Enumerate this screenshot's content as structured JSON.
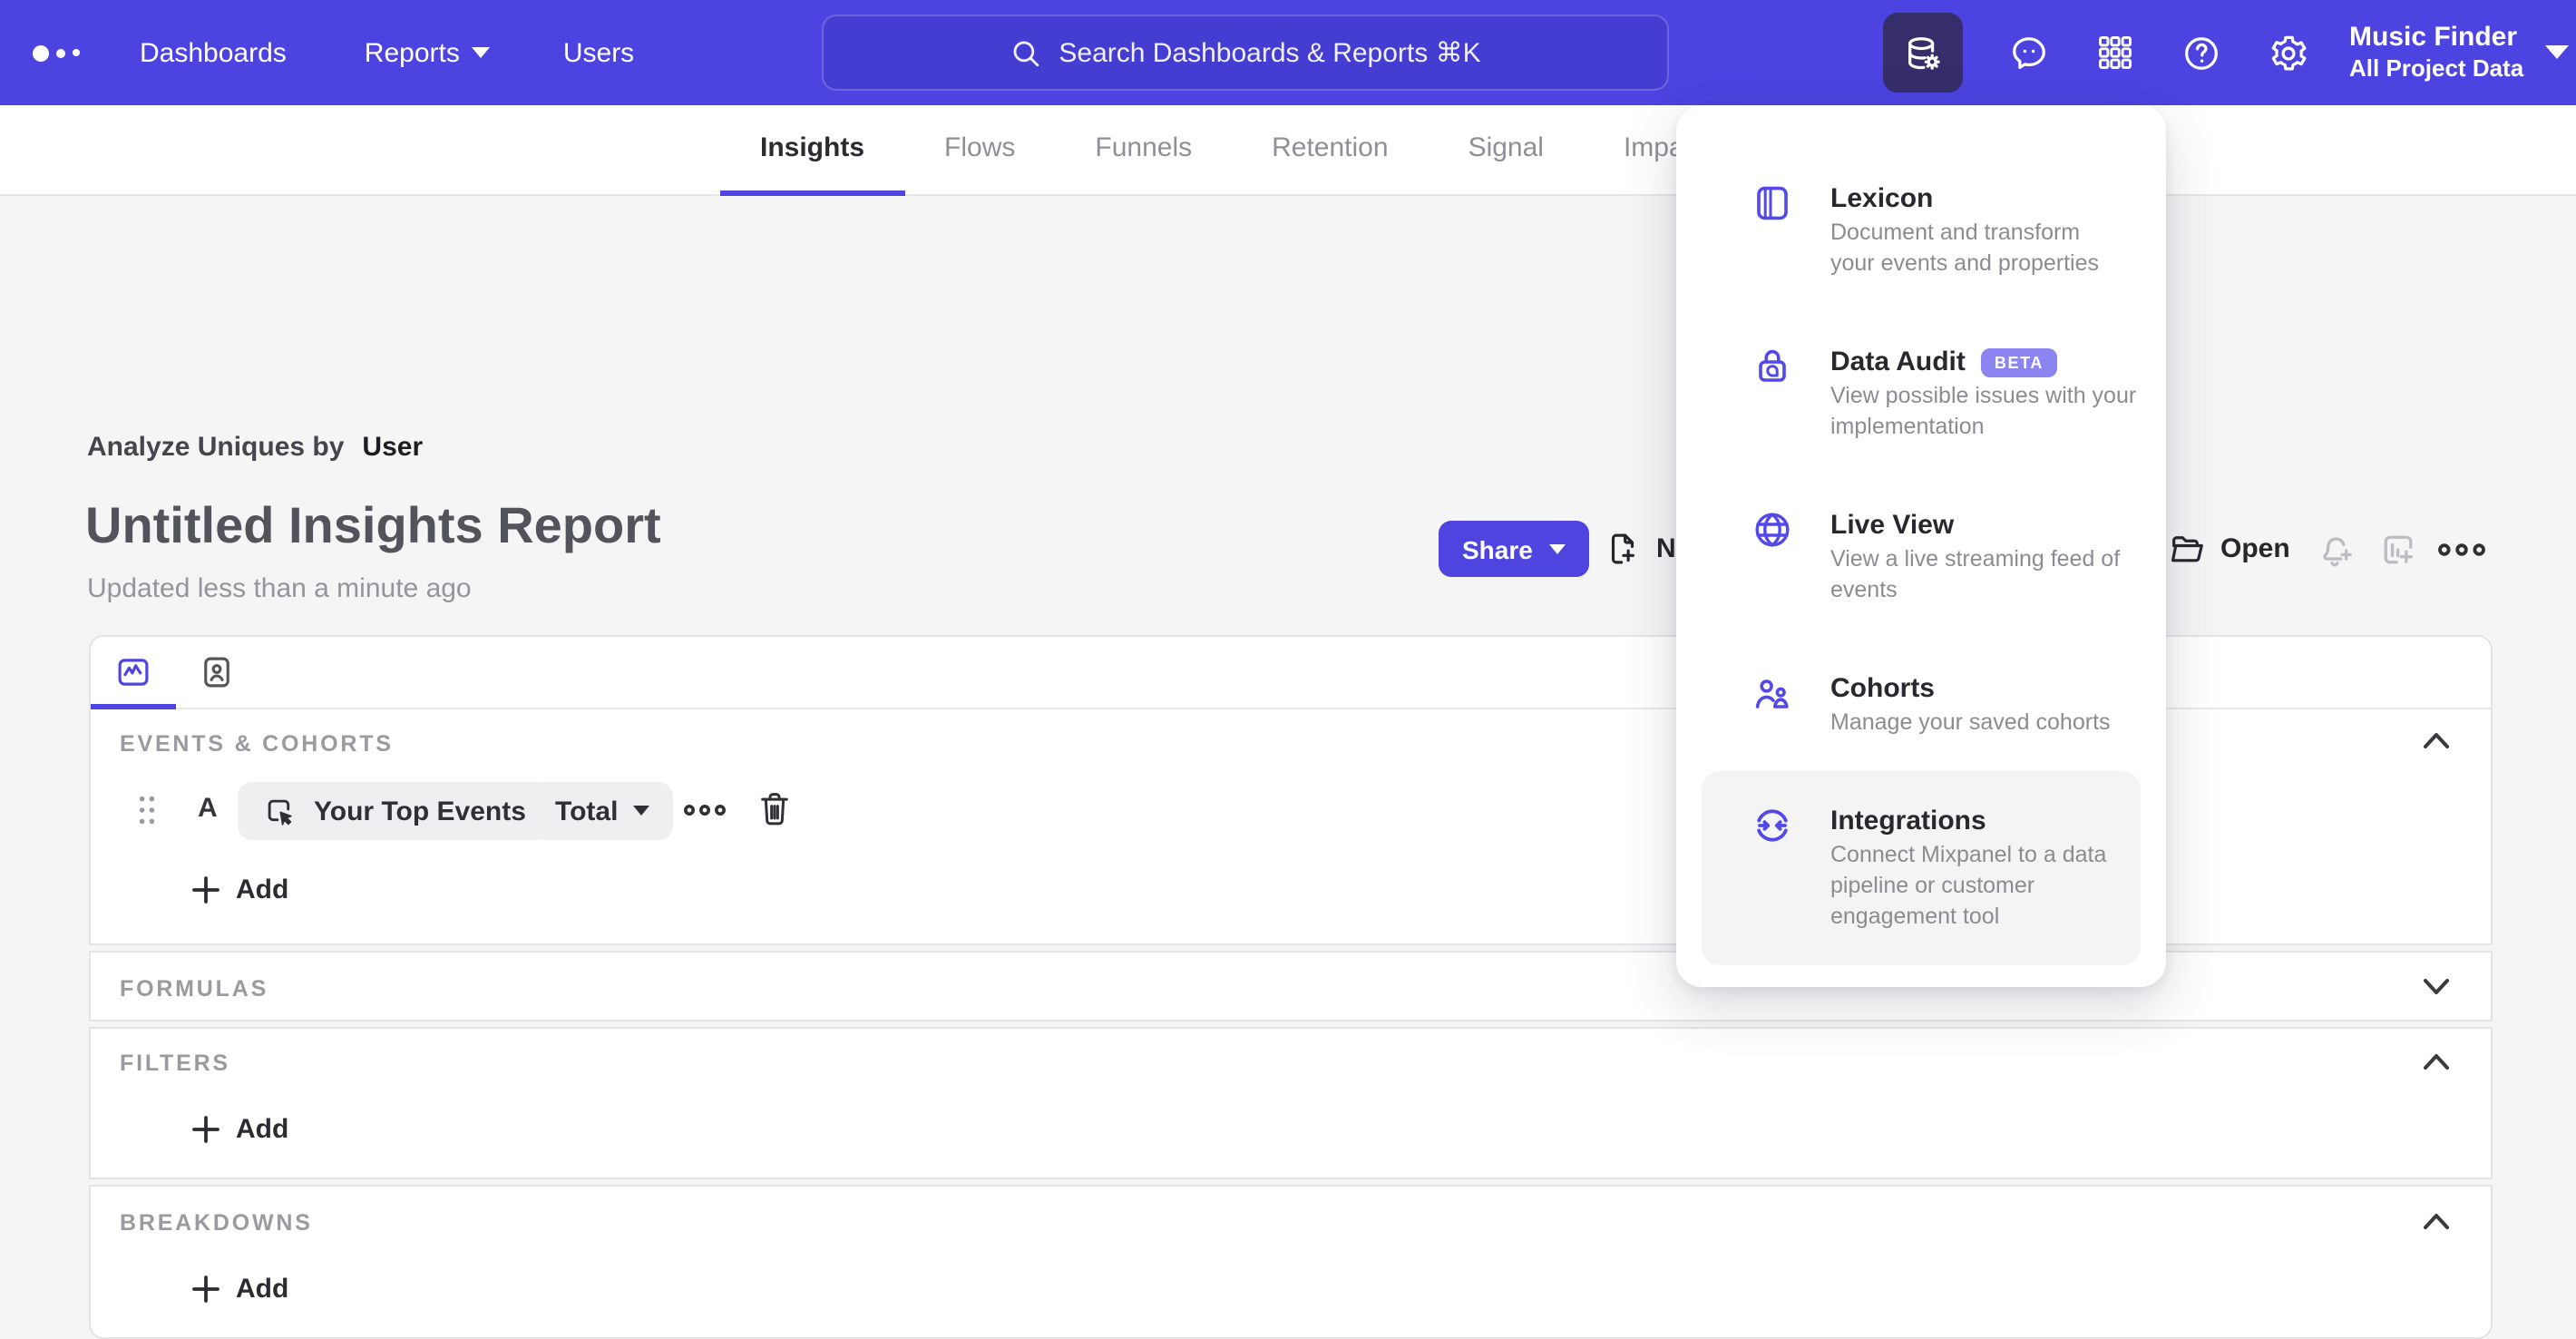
{
  "nav": {
    "links": [
      {
        "label": "Dashboards"
      },
      {
        "label": "Reports"
      },
      {
        "label": "Users"
      }
    ],
    "search": {
      "placeholder": "Search Dashboards & Reports ⌘K"
    },
    "project": {
      "name": "Music Finder",
      "scope": "All Project Data"
    }
  },
  "tabs": {
    "items": [
      {
        "label": "Insights"
      },
      {
        "label": "Flows"
      },
      {
        "label": "Funnels"
      },
      {
        "label": "Retention"
      },
      {
        "label": "Signal"
      },
      {
        "label": "Impact"
      }
    ],
    "active": "Insights"
  },
  "header": {
    "analyze_label": "Analyze Uniques by",
    "analyze_value": "User",
    "title": "Untitled Insights Report",
    "updated": "Updated less than a minute ago",
    "share": "Share",
    "new": "New",
    "open": "Open"
  },
  "builder": {
    "events_section": "EVENTS & COHORTS",
    "row": {
      "letter": "A",
      "event": "Your Top Events",
      "metric": "Total"
    },
    "add": "Add",
    "formulas_section": "FORMULAS",
    "filters_section": "FILTERS",
    "breakdowns_section": "BREAKDOWNS"
  },
  "menu": {
    "items": [
      {
        "title": "Lexicon",
        "desc": "Document and transform\nyour events and properties"
      },
      {
        "title": "Data Audit",
        "badge": "BETA",
        "desc": "View possible issues with your\nimplementation"
      },
      {
        "title": "Live View",
        "desc": "View a live streaming feed of\nevents"
      },
      {
        "title": "Cohorts",
        "desc": "Manage your saved cohorts"
      },
      {
        "title": "Integrations",
        "desc": "Connect Mixpanel to a data\npipeline or customer\nengagement tool",
        "highlighted": true
      }
    ]
  },
  "colors": {
    "nav": "#4C43E0",
    "accent": "#4F44E0",
    "active_icon_bg": "#352E6B",
    "badge": "#8C84F0",
    "background": "#f5f5f6"
  }
}
